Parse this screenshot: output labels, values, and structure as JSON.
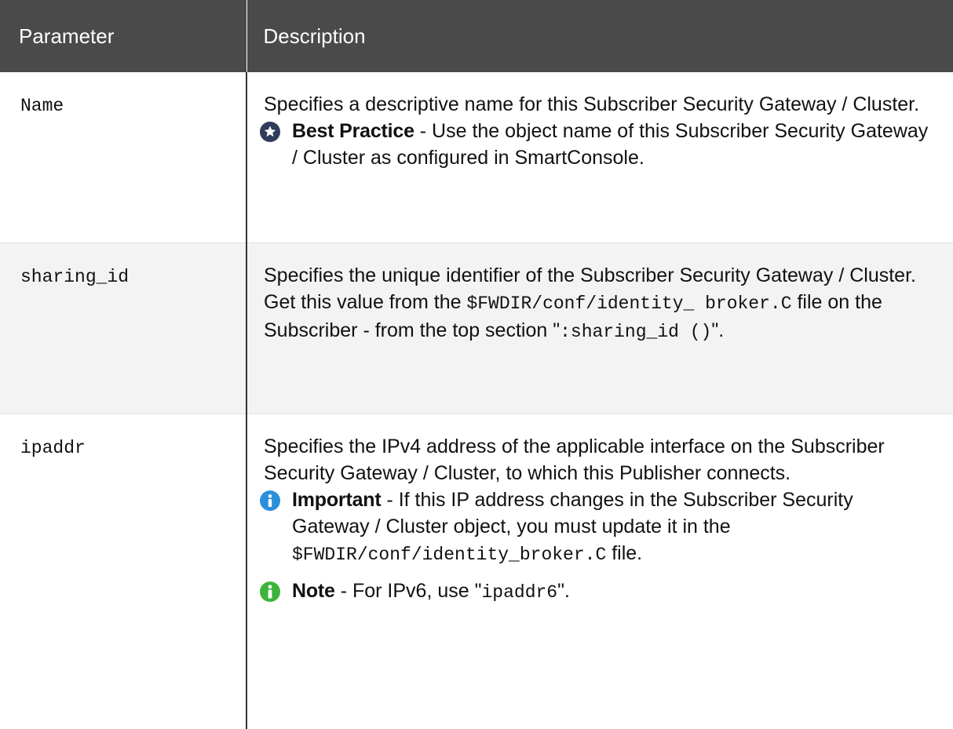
{
  "header": {
    "col1": "Parameter",
    "col2": "Description"
  },
  "rows": [
    {
      "param": "Name",
      "desc": "Specifies a descriptive name for this Subscriber Security Gateway / Cluster.",
      "note": {
        "icon": "best-practice-star-icon",
        "icon_color": "#2f3d5a",
        "label": "Best Practice",
        "text": " - Use the object name of this Subscriber Security Gateway / Cluster as configured in SmartConsole."
      }
    },
    {
      "param": "sharing_id",
      "desc": "Specifies the unique identifier of the Subscriber Security Gateway / Cluster.",
      "desc2_pre": "Get this value from the ",
      "desc2_code": "$FWDIR/conf/identity_ broker.C",
      "desc2_mid": " file on the Subscriber - from the top section \"",
      "desc2_code2": ":sharing_id ()",
      "desc2_post": "\"."
    },
    {
      "param": "ipaddr",
      "desc": "Specifies the IPv4 address of the applicable interface on the Subscriber Security Gateway / Cluster, to which this Publisher connects.",
      "important": {
        "icon": "info-icon",
        "icon_color": "#2b8fd9",
        "label": "Important",
        "text_pre": " - If this IP address changes in the Subscriber Security Gateway / Cluster object, you must update it in the ",
        "code": "$FWDIR/conf/identity_broker.C",
        "text_post": " file."
      },
      "note": {
        "icon": "note-info-icon",
        "icon_color": "#3cb43c",
        "label": "Note",
        "text_pre": " - For IPv6, use \"",
        "code": "ipaddr6",
        "text_post": "\"."
      }
    }
  ]
}
